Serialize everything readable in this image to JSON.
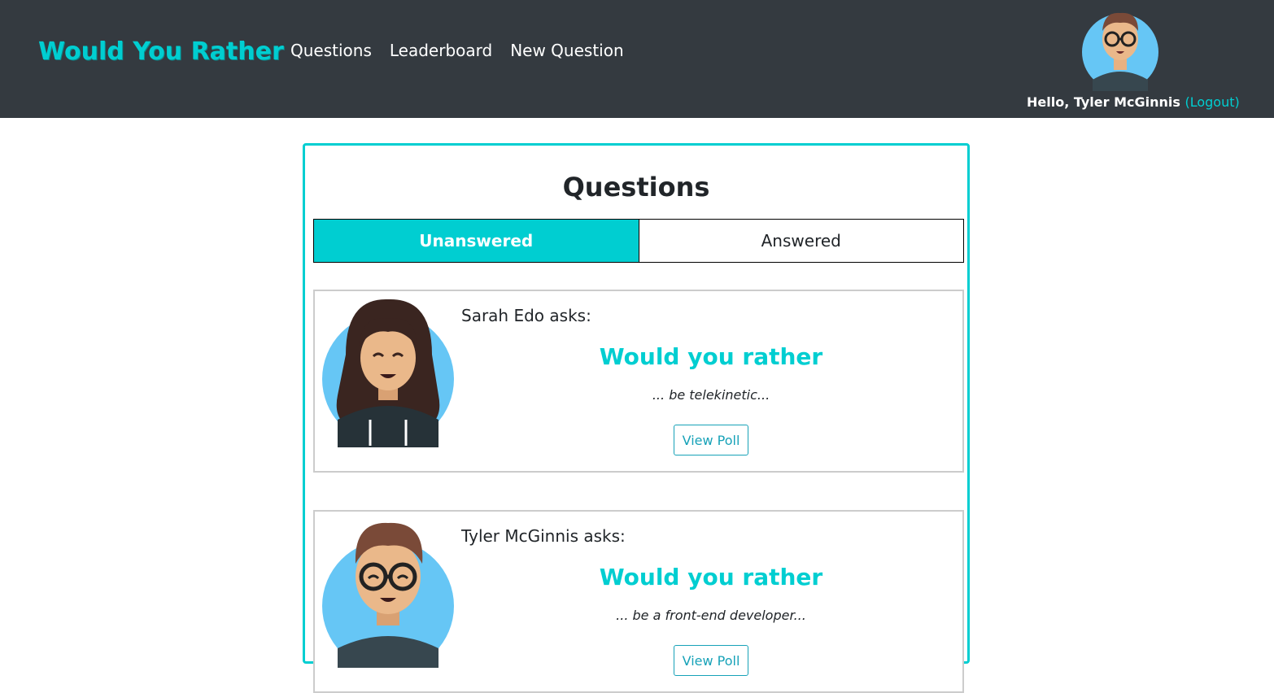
{
  "nav": {
    "brand": "Would You Rather",
    "links": [
      "Questions",
      "Leaderboard",
      "New Question"
    ],
    "greeting": "Hello, Tyler McGinnis",
    "logout": "(Logout)"
  },
  "panel": {
    "title": "Questions",
    "tabs": [
      {
        "label": "Unanswered",
        "active": true
      },
      {
        "label": "Answered",
        "active": false
      }
    ]
  },
  "questions": [
    {
      "asker": "Sarah Edo asks:",
      "heading": "Would you rather",
      "option": "... be telekinetic...",
      "button": "View Poll",
      "avatar": "woman-avatar-icon"
    },
    {
      "asker": "Tyler McGinnis asks:",
      "heading": "Would you rather",
      "option": "... be a front-end developer...",
      "button": "View Poll",
      "avatar": "man-glasses-avatar-icon"
    }
  ],
  "colors": {
    "accent": "#00ced1",
    "navbar": "#343a40",
    "button": "#17a2b8"
  }
}
